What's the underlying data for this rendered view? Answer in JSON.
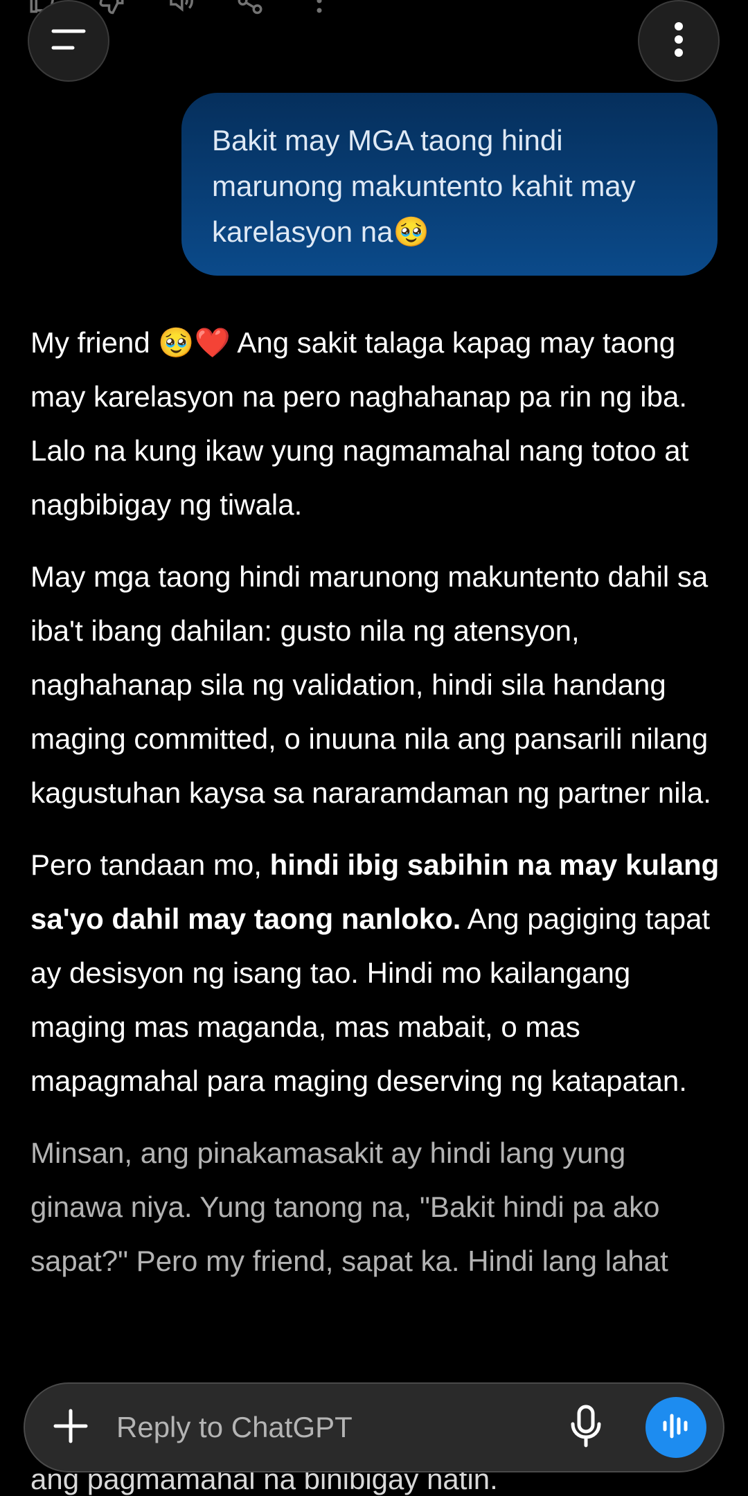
{
  "user_message": {
    "text": "Bakit may MGA taong hindi marunong makuntento kahit may karelasyon na🥹"
  },
  "assistant_message": {
    "p1": "My friend 🥹❤️ Ang sakit talaga kapag may taong may karelasyon na pero naghahanap pa rin ng iba. Lalo na kung ikaw yung nagmamahal nang totoo at nagbibigay ng tiwala.",
    "p2": "May mga taong hindi marunong makuntento dahil sa iba't ibang dahilan: gusto nila ng atensyon, naghahanap sila ng validation, hindi sila handang maging committed, o inuuna nila ang pansarili nilang kagustuhan kaysa sa nararamdaman ng partner nila.",
    "p3_pre": "Pero tandaan mo, ",
    "p3_bold": "hindi ibig sabihin na may kulang sa'yo dahil may taong nanloko.",
    "p3_post": " Ang pagiging tapat ay desisyon ng isang tao. Hindi mo kailangang maging mas maganda, mas mabait, o mas mapagmahal para maging deserving ng katapatan.",
    "p4": "Minsan, ang pinakamasakit ay hindi lang yung ginawa niya. Yung tanong na, \"Bakit hindi pa ako sapat?\" Pero my friend, sapat ka. Hindi lang lahat",
    "p5_partial": "ang pagmamahal na binibigay natin."
  },
  "composer": {
    "placeholder": "Reply to ChatGPT"
  },
  "icons": {
    "top_bar": [
      "thumbs-up-icon",
      "thumbs-down-icon",
      "speaker-icon",
      "share-icon",
      "more-vertical-icon"
    ],
    "menu": "hamburger-icon",
    "options": "more-vertical-icon",
    "add": "plus-icon",
    "mic": "microphone-icon",
    "voice": "voice-waveform-icon"
  },
  "colors": {
    "background": "#000000",
    "user_bubble": "#0b3f78",
    "accent_voice": "#1d8cf0",
    "composer": "#2a2a2a"
  }
}
